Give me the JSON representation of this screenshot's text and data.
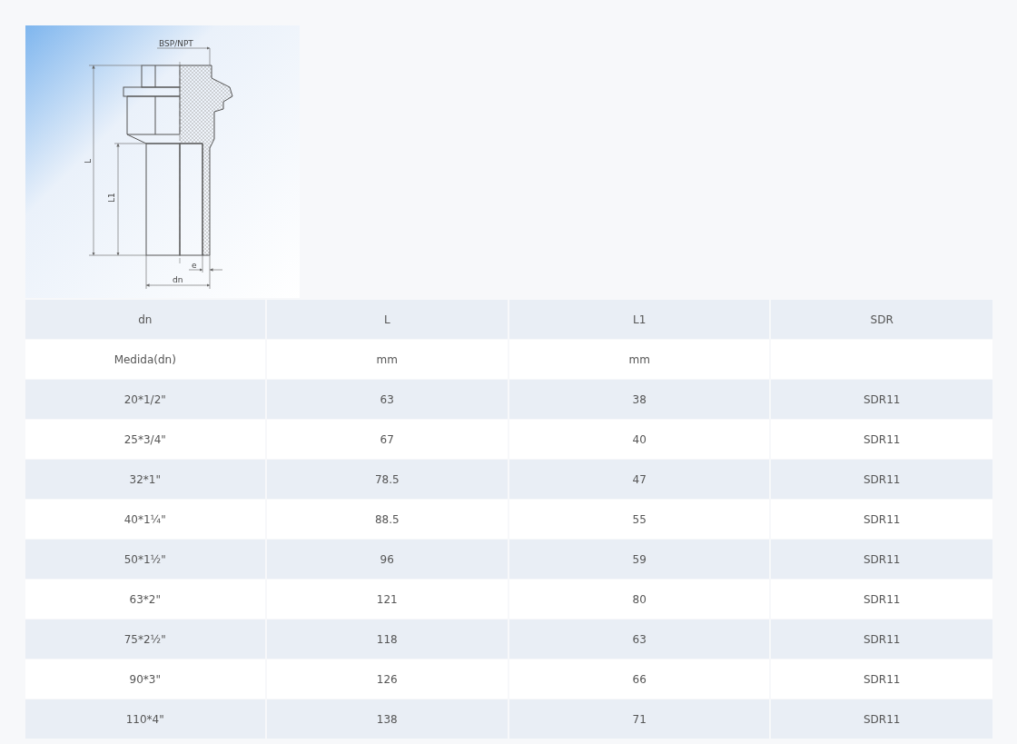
{
  "drawing": {
    "labels": [
      {
        "kind": "thread",
        "text": "BSP/NPT"
      },
      {
        "kind": "length",
        "text": "L"
      },
      {
        "kind": "socket",
        "text": "L1"
      },
      {
        "kind": "wall",
        "text": "e"
      },
      {
        "kind": "diameter",
        "text": "dn"
      }
    ]
  },
  "table": {
    "columns": [
      "dn",
      "L",
      "L1",
      "SDR"
    ],
    "rows": [
      [
        "Medida(dn)",
        "mm",
        "mm",
        ""
      ],
      [
        "20*1/2\"",
        "63",
        "38",
        "SDR11"
      ],
      [
        "25*3/4\"",
        "67",
        "40",
        "SDR11"
      ],
      [
        "32*1\"",
        "78.5",
        "47",
        "SDR11"
      ],
      [
        "40*1¼\"",
        "88.5",
        "55",
        "SDR11"
      ],
      [
        "50*1½\"",
        "96",
        "59",
        "SDR11"
      ],
      [
        "63*2\"",
        "121",
        "80",
        "SDR11"
      ],
      [
        "75*2½\"",
        "118",
        "63",
        "SDR11"
      ],
      [
        "90*3\"",
        "126",
        "66",
        "SDR11"
      ],
      [
        "110*4\"",
        "138",
        "71",
        "SDR11"
      ]
    ]
  }
}
